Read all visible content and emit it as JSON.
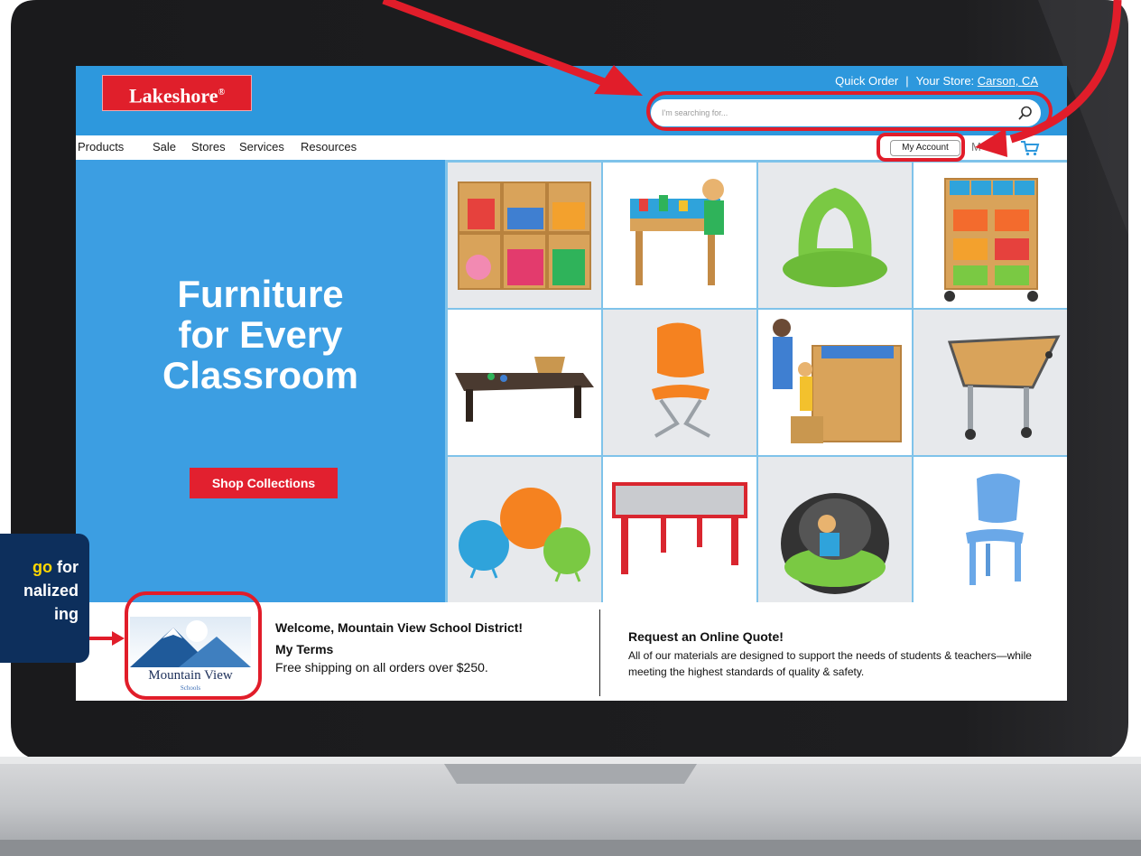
{
  "colors": {
    "header_blue": "#2d98dd",
    "hero_blue": "#3c9ee2",
    "brand_red": "#e01f2b",
    "annotation_red": "#e11d2a",
    "callout_navy": "#0d2f5c",
    "highlight_yellow": "#ffd800"
  },
  "header": {
    "logo_text": "Lakeshore",
    "logo_mark": "®",
    "quick_order": "Quick Order",
    "separator": "|",
    "store_prefix": "Your Store: ",
    "store_name": "Carson, CA",
    "search_placeholder": "I'm searching for...",
    "search_icon": "search-icon"
  },
  "nav": {
    "items": [
      "Products",
      "Sale",
      "Stores",
      "Services",
      "Resources"
    ],
    "account_label": "My Account",
    "extra_label": "M",
    "cart_icon": "cart-icon"
  },
  "hero": {
    "title_lines": [
      "Furniture",
      "for Every",
      "Classroom"
    ],
    "cta_label": "Shop Collections"
  },
  "products": [
    "storage-shelf-with-bins",
    "child-at-building-table",
    "green-floor-rocker",
    "mobile-bin-storage-cart",
    "low-table-with-toys",
    "orange-stack-chair",
    "teacher-and-child-at-sink",
    "trapezoid-activity-table",
    "balance-ball-seats",
    "red-adjustable-table",
    "reading-pod-with-child",
    "blue-stack-chair"
  ],
  "partner": {
    "logo_name": "Mountain View",
    "logo_sub": "Schools",
    "welcome": "Welcome, Mountain View School District!",
    "terms_title": "My Terms",
    "terms_text": "Free shipping on all orders over $250."
  },
  "quote": {
    "title": "Request an Online Quote!",
    "text": "All of our materials are designed to support the needs of students & teachers—while meeting the highest standards of quality & safety."
  },
  "callout": {
    "line1_highlight": "go",
    "line1_rest": " for",
    "line2": "nalized",
    "line3": "ing"
  }
}
